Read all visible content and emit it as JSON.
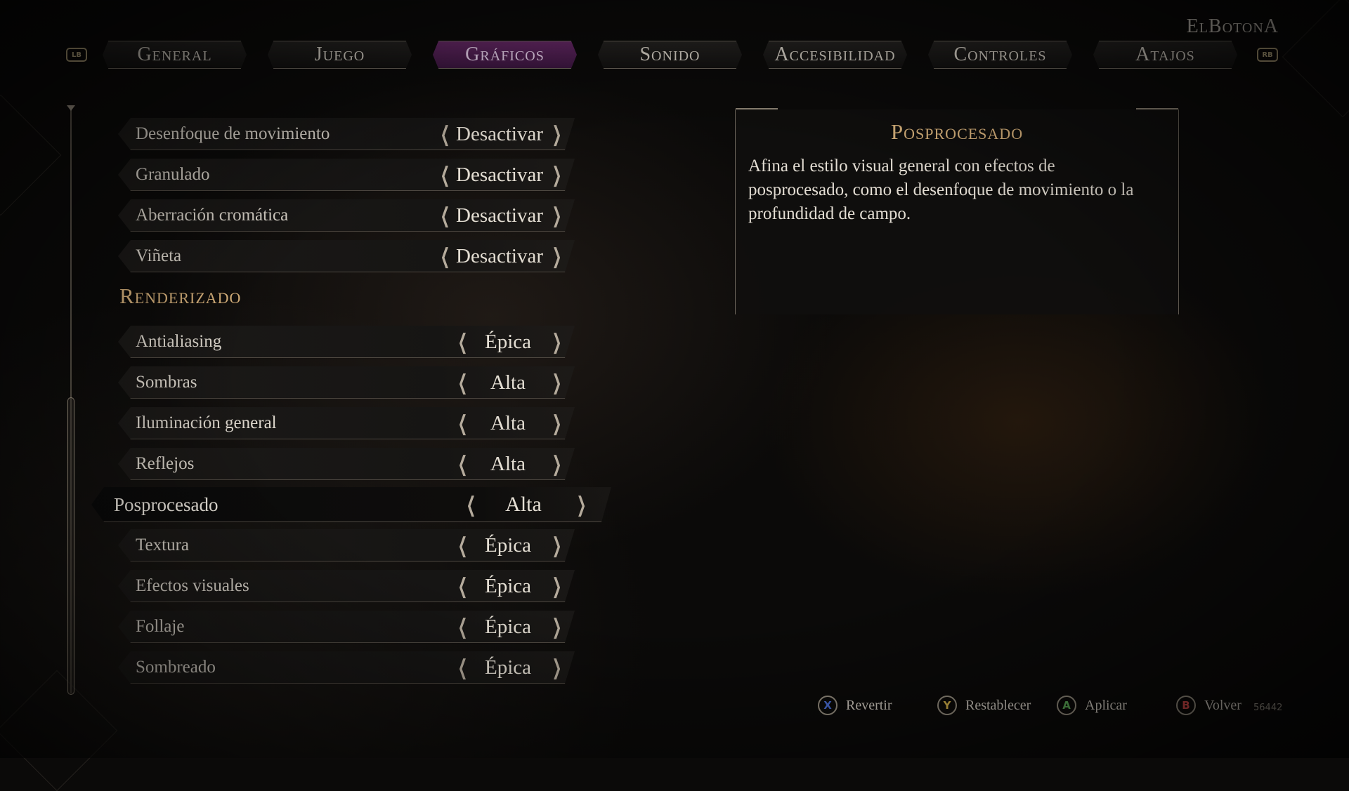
{
  "header": {
    "username": "ElBotonA"
  },
  "tabs": {
    "left_bumper": "LB",
    "right_bumper": "RB",
    "items": [
      {
        "label": "General",
        "active": false
      },
      {
        "label": "Juego",
        "active": false
      },
      {
        "label": "Gráficos",
        "active": true
      },
      {
        "label": "Sonido",
        "active": false
      },
      {
        "label": "Accesibilidad",
        "active": false
      },
      {
        "label": "Controles",
        "active": false
      },
      {
        "label": "Atajos",
        "active": false
      }
    ]
  },
  "settings": {
    "postfx_items": [
      {
        "label": "Desenfoque de movimiento",
        "value": "Desactivar"
      },
      {
        "label": "Granulado",
        "value": "Desactivar"
      },
      {
        "label": "Aberración cromática",
        "value": "Desactivar"
      },
      {
        "label": "Viñeta",
        "value": "Desactivar"
      }
    ],
    "section_rendering": "Renderizado",
    "rendering_items": [
      {
        "label": "Antialiasing",
        "value": "Épica"
      },
      {
        "label": "Sombras",
        "value": "Alta"
      },
      {
        "label": "Iluminación general",
        "value": "Alta"
      },
      {
        "label": "Reflejos",
        "value": "Alta"
      },
      {
        "label": "Posprocesado",
        "value": "Alta",
        "selected": true
      },
      {
        "label": "Textura",
        "value": "Épica"
      },
      {
        "label": "Efectos visuales",
        "value": "Épica"
      },
      {
        "label": "Follaje",
        "value": "Épica"
      },
      {
        "label": "Sombreado",
        "value": "Épica"
      }
    ],
    "arrow_left": "❮",
    "arrow_right": "❯"
  },
  "description": {
    "title": "Posprocesado",
    "text": "Afina el estilo visual general con efectos de posprocesado, como el desenfoque de movimiento o la profundidad de campo."
  },
  "footer": {
    "prompts": [
      {
        "button": "X",
        "label": "Revertir",
        "color": "#4a6fd8"
      },
      {
        "button": "Y",
        "label": "Restablecer",
        "color": "#d6b34a"
      },
      {
        "button": "A",
        "label": "Aplicar",
        "color": "#5fb05a"
      },
      {
        "button": "B",
        "label": "Volver",
        "color": "#d84a4a"
      }
    ],
    "build": "56442"
  },
  "colors": {
    "accent_gold": "#d8b27c",
    "active_tab": "#5a215c"
  }
}
